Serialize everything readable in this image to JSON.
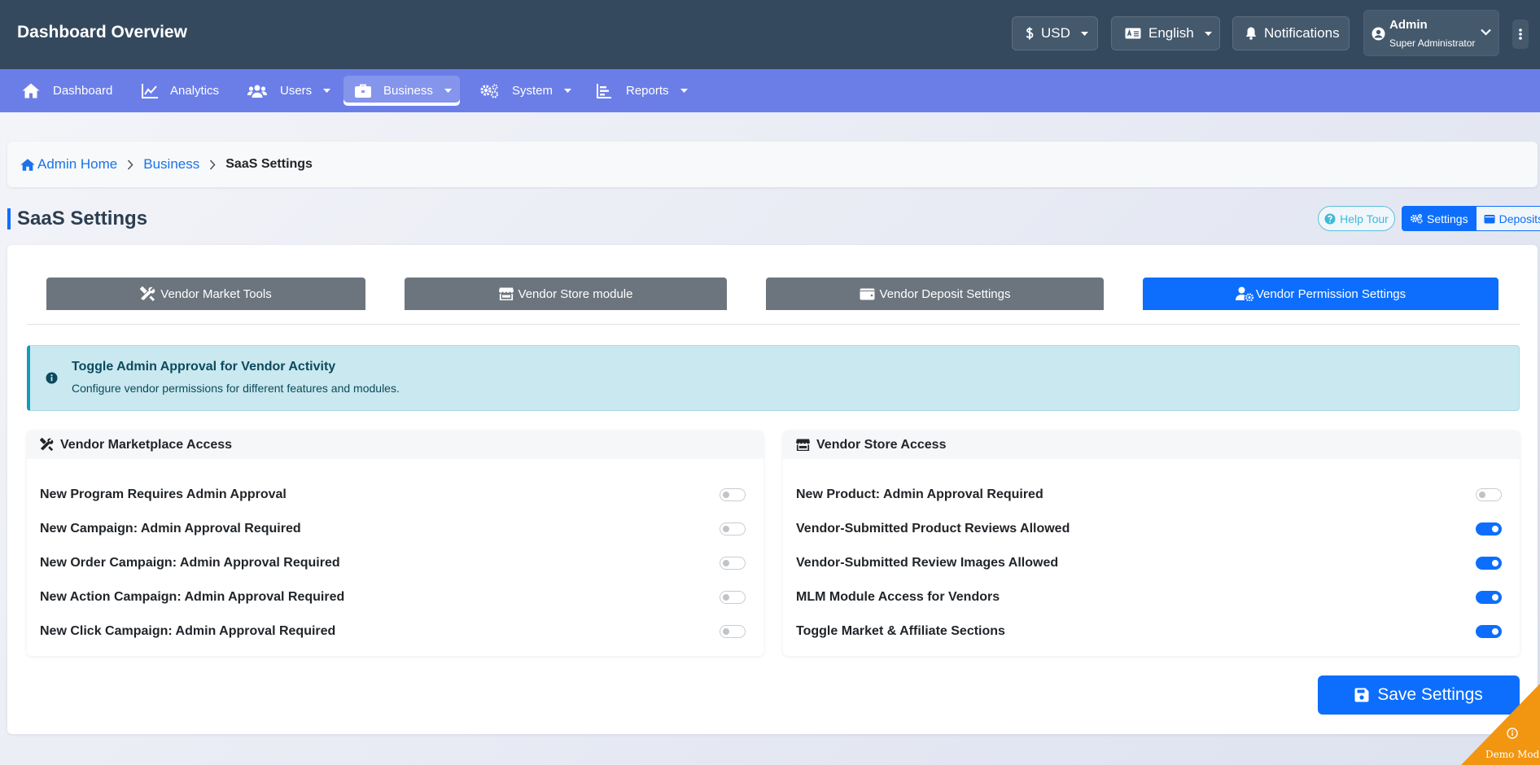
{
  "header": {
    "title": "Dashboard Overview",
    "currency_label": "USD",
    "language_label": "English",
    "notifications_label": "Notifications",
    "user_name": "Admin",
    "user_role": "Super Administrator"
  },
  "nav": {
    "items": [
      {
        "label": "Dashboard",
        "icon": "home-icon"
      },
      {
        "label": "Analytics",
        "icon": "chart-line-icon"
      },
      {
        "label": "Users",
        "icon": "users-icon"
      },
      {
        "label": "Business",
        "icon": "briefcase-icon",
        "active": true
      },
      {
        "label": "System",
        "icon": "gears-icon"
      },
      {
        "label": "Reports",
        "icon": "chart-bar-icon"
      }
    ]
  },
  "breadcrumb": {
    "home": "Admin Home",
    "parent": "Business",
    "current": "SaaS Settings"
  },
  "page": {
    "title": "SaaS Settings",
    "help_label": "Help Tour",
    "settings_label": "Settings",
    "deposits_label": "Deposits"
  },
  "tabs": [
    {
      "label": "Vendor Market Tools",
      "icon": "tools-icon"
    },
    {
      "label": "Vendor Store module",
      "icon": "store-icon"
    },
    {
      "label": "Vendor Deposit Settings",
      "icon": "wallet-icon"
    },
    {
      "label": "Vendor Permission Settings",
      "icon": "user-gear-icon",
      "active": true
    }
  ],
  "alert": {
    "title": "Toggle Admin Approval for Vendor Activity",
    "text": "Configure vendor permissions for different features and modules."
  },
  "marketplace": {
    "title": "Vendor Marketplace Access",
    "rows": [
      {
        "label": "New Program Requires Admin Approval",
        "on": false
      },
      {
        "label": "New Campaign: Admin Approval Required",
        "on": false
      },
      {
        "label": "New Order Campaign: Admin Approval Required",
        "on": false
      },
      {
        "label": "New Action Campaign: Admin Approval Required",
        "on": false
      },
      {
        "label": "New Click Campaign: Admin Approval Required",
        "on": false
      }
    ]
  },
  "store": {
    "title": "Vendor Store Access",
    "rows": [
      {
        "label": "New Product: Admin Approval Required",
        "on": false
      },
      {
        "label": "Vendor-Submitted Product Reviews Allowed",
        "on": true
      },
      {
        "label": "Vendor-Submitted Review Images Allowed",
        "on": true
      },
      {
        "label": "MLM Module Access for Vendors",
        "on": true
      },
      {
        "label": "Toggle Market & Affiliate Sections",
        "on": true
      }
    ]
  },
  "save_label": "Save Settings",
  "demo_label": "Demo Mode",
  "colors": {
    "header_bg": "#34495e",
    "nav_bg": "#6b7ee8",
    "primary": "#0d6efd",
    "tab_inactive": "#6c757d",
    "alert_bg": "#cae8ef",
    "ribbon": "#f29611"
  }
}
